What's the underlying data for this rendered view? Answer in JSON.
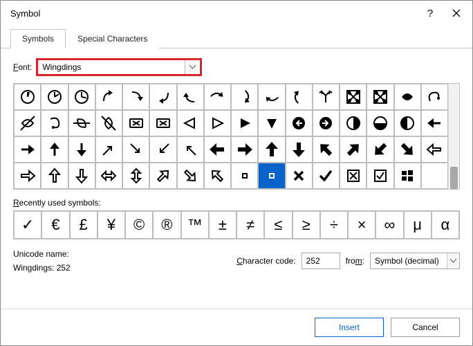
{
  "title": "Symbol",
  "tabs": {
    "symbols": "Symbols",
    "special": "Special Characters"
  },
  "font": {
    "label_prefix": "F",
    "label_rest": "ont:",
    "value": "Wingdings"
  },
  "recent_label": "Recently used symbols:",
  "recent": [
    "✓",
    "€",
    "£",
    "¥",
    "©",
    "®",
    "™",
    "±",
    "≠",
    "≤",
    "≥",
    "÷",
    "×",
    "∞",
    "μ",
    "α"
  ],
  "unicode_name_label": "Unicode name:",
  "unicode_name_value": "Wingdings: 252",
  "charcode": {
    "label_prefix": "C",
    "label_rest": "haracter code:",
    "value": "252"
  },
  "from": {
    "label_prefix": "fro",
    "label_rest": "m:",
    "value": "Symbol (decimal)"
  },
  "buttons": {
    "insert": "Insert",
    "cancel": "Cancel"
  },
  "selected_glyph": "✓",
  "grid_selected_index": 57,
  "colors": {
    "accent": "#0a63c9",
    "highlight_border": "#d9262c"
  }
}
